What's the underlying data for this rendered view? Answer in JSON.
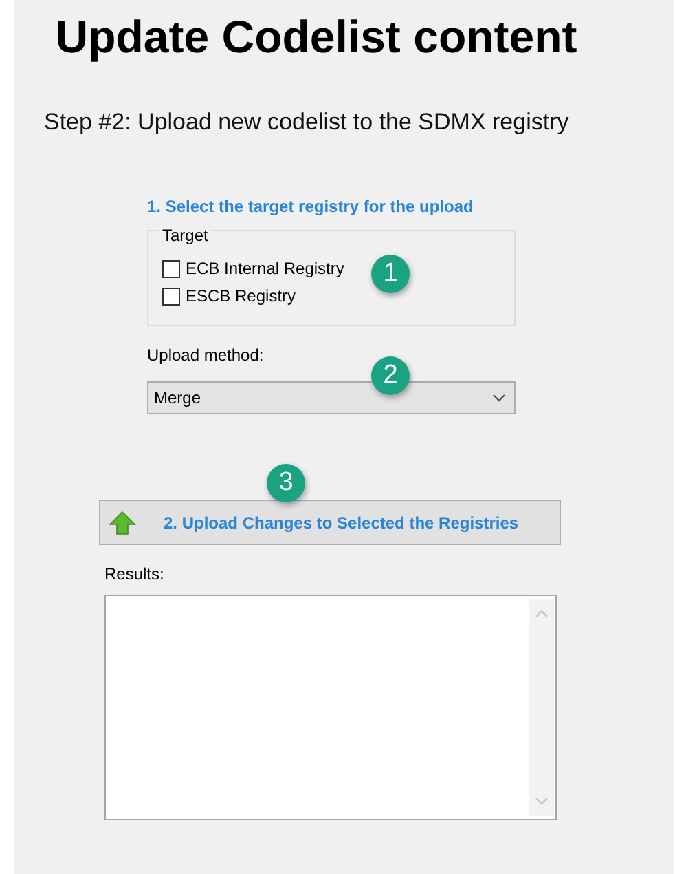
{
  "title": "Update Codelist content",
  "step": "Step #2: Upload new codelist to the SDMX registry",
  "section_heading": "1. Select the target registry for the upload",
  "target_group": {
    "legend": "Target",
    "options": [
      {
        "label": "ECB Internal Registry",
        "checked": false
      },
      {
        "label": "ESCB Registry",
        "checked": false
      }
    ]
  },
  "upload_method": {
    "label": "Upload method:",
    "value": "Merge"
  },
  "upload_button": {
    "label": "2. Upload Changes to Selected the Registries"
  },
  "results": {
    "label": "Results:"
  },
  "callouts": [
    "1",
    "2",
    "3"
  ]
}
